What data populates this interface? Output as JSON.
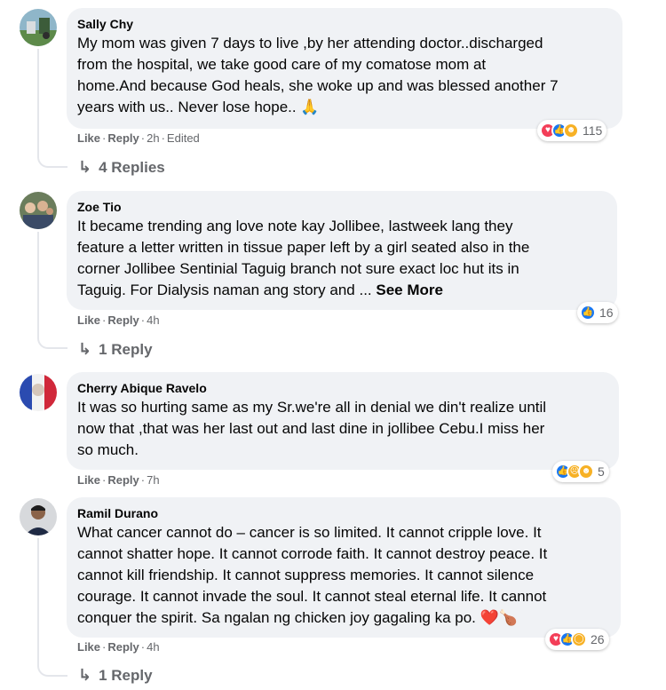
{
  "comments": [
    {
      "author": "Sally Chy",
      "text_lines": [
        "My mom was given 7 days to live ,by her attending doctor..discharged",
        "from the hospital, we take good care of my comatose mom at",
        "home.And because God heals, she woke up and was blessed another 7",
        "years with us.. Never lose hope.. 🙏"
      ],
      "like_label": "Like",
      "reply_label": "Reply",
      "time": "2h",
      "edited": "Edited",
      "reaction_icons": [
        "love-icon",
        "like-icon",
        "care-icon"
      ],
      "reaction_count": "115",
      "replies_label": "4 Replies"
    },
    {
      "author": "Zoe Tio",
      "text_lines": [
        "It became trending ang love note kay Jollibee, lastweek lang they",
        "feature a letter written in tissue paper left by a girl seated also in the",
        "corner Jollibee Sentinial Taguig branch not sure exact loc hut its in",
        "Taguig. For Dialysis naman ang story and ... "
      ],
      "see_more": "See More",
      "like_label": "Like",
      "reply_label": "Reply",
      "time": "4h",
      "reaction_icons": [
        "like-icon"
      ],
      "reaction_count": "16",
      "replies_label": "1 Reply"
    },
    {
      "author": "Cherry Abique Ravelo",
      "text_lines": [
        "It was so hurting same as my Sr.we're all in denial we din't realize until",
        "now that ,that was her last out and last dine in jollibee Cebu.I miss her",
        "so much."
      ],
      "like_label": "Like",
      "reply_label": "Reply",
      "time": "7h",
      "reaction_icons": [
        "like-icon",
        "sad-icon",
        "care-icon"
      ],
      "reaction_count": "5"
    },
    {
      "author": "Ramil Durano",
      "text_lines": [
        "What cancer cannot do – cancer is so limited. It cannot cripple love. It",
        "cannot shatter hope. It cannot corrode faith. It cannot destroy peace. It",
        "cannot kill friendship. It cannot suppress memories. It cannot silence",
        "courage. It cannot invade the soul. It cannot steal eternal life. It cannot",
        "conquer the spirit. Sa ngalan ng chicken joy gagaling ka po. ❤️🍗"
      ],
      "like_label": "Like",
      "reply_label": "Reply",
      "time": "4h",
      "reaction_icons": [
        "love-icon",
        "like-icon",
        "wow-icon"
      ],
      "reaction_count": "26",
      "replies_label": "1 Reply"
    }
  ],
  "colors": {
    "bubble_bg": "#f0f2f5",
    "secondary_text": "#65676b",
    "like_blue": "#1877f2",
    "love_red": "#f33e58",
    "emoji_yellow": "#f7b125"
  }
}
